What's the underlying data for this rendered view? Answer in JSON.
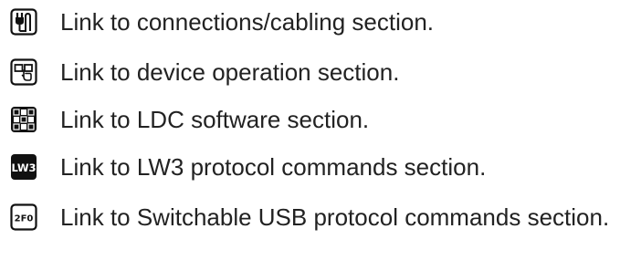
{
  "legend": {
    "items": [
      {
        "icon": "plug-icon",
        "label": "Link to connections/cabling section."
      },
      {
        "icon": "device-operation-icon",
        "label": "Link to device operation section."
      },
      {
        "icon": "ldc-software-icon",
        "label": "Link to LDC software section."
      },
      {
        "icon": "lw3-icon",
        "icon_text": "LW3",
        "label": "Link to LW3 protocol commands section."
      },
      {
        "icon": "2f0-icon",
        "icon_text": "2F0",
        "label": "Link to Switchable USB protocol commands section."
      }
    ]
  },
  "colors": {
    "text": "#222222",
    "icon_stroke": "#111111",
    "icon_fill": "#111111",
    "background": "#ffffff"
  }
}
